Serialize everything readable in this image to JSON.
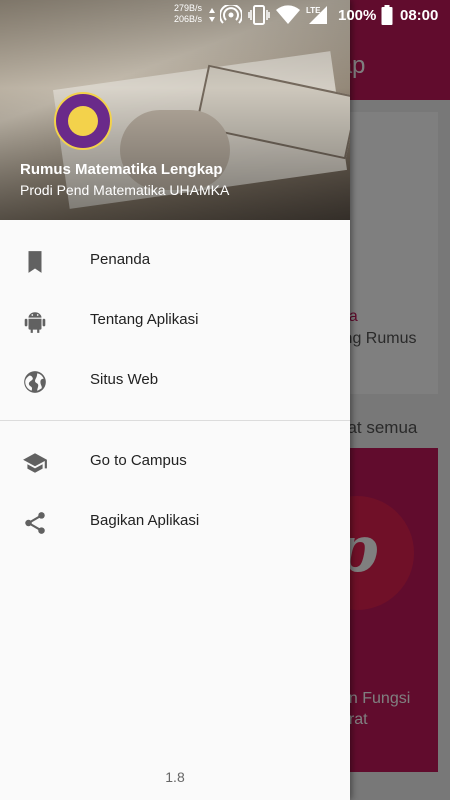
{
  "status_bar": {
    "net_up": "279B/s",
    "net_down": "206B/s",
    "battery": "100%",
    "time": "08:00",
    "icons": [
      "hotspot-icon",
      "vibrate-icon",
      "wifi-icon",
      "lte-signal-icon",
      "battery-icon"
    ]
  },
  "background_app": {
    "title": "ngkap",
    "card_title": "da",
    "card_subtitle": "ing Rumus",
    "see_all": "hat semua",
    "card2_line1": "an Fungsi",
    "card2_line2": "drat"
  },
  "drawer": {
    "header": {
      "title": "Rumus Matematika Lengkap",
      "subtitle": "Prodi Pend Matematika UHAMKA"
    },
    "items": [
      {
        "label": "Penanda",
        "icon": "bookmark-icon"
      },
      {
        "label": "Tentang Aplikasi",
        "icon": "android-icon"
      },
      {
        "label": "Situs Web",
        "icon": "globe-icon"
      },
      {
        "label": "Go to Campus",
        "icon": "graduation-cap-icon"
      },
      {
        "label": "Bagikan Aplikasi",
        "icon": "share-icon"
      }
    ],
    "version": "1.8"
  },
  "colors": {
    "primary": "#c2185b",
    "icon": "#616161"
  }
}
